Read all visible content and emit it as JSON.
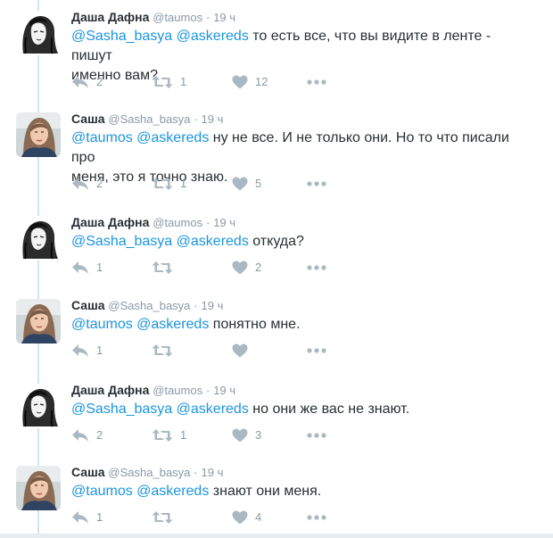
{
  "tweets": [
    {
      "author": "dasha",
      "name": "Даша Дафна",
      "handle": "@taumos",
      "dot": "·",
      "time": "19 ч",
      "mentions": "@Sasha_basya @askereds",
      "text_line1": " то есть все, что вы видите в ленте - пишут",
      "text_line2": "именно вам?",
      "replies": "2",
      "retweets": "1",
      "likes": "12"
    },
    {
      "author": "sasha",
      "name": "Саша",
      "handle": "@Sasha_basya",
      "dot": "·",
      "time": "19 ч",
      "mentions": "@taumos @askereds",
      "text_line1": " ну не все. И не только они. Но то что писали про",
      "text_line2": "меня, это я точно знаю.",
      "replies": "2",
      "retweets": "1",
      "likes": "5"
    },
    {
      "author": "dasha",
      "name": "Даша Дафна",
      "handle": "@taumos",
      "dot": "·",
      "time": "19 ч",
      "mentions": "@Sasha_basya @askereds",
      "text_line1": " откуда?",
      "text_line2": "",
      "replies": "1",
      "retweets": "",
      "likes": "2"
    },
    {
      "author": "sasha",
      "name": "Саша",
      "handle": "@Sasha_basya",
      "dot": "·",
      "time": "19 ч",
      "mentions": "@taumos @askereds",
      "text_line1": " понятно мне.",
      "text_line2": "",
      "replies": "1",
      "retweets": "",
      "likes": ""
    },
    {
      "author": "dasha",
      "name": "Даша Дафна",
      "handle": "@taumos",
      "dot": "·",
      "time": "19 ч",
      "mentions": "@Sasha_basya @askereds",
      "text_line1": " но они же вас не знают.",
      "text_line2": "",
      "replies": "2",
      "retweets": "1",
      "likes": "3"
    },
    {
      "author": "sasha",
      "name": "Саша",
      "handle": "@Sasha_basya",
      "dot": "·",
      "time": "19 ч",
      "mentions": "@taumos @askereds",
      "text_line1": " знают они меня.",
      "text_line2": "",
      "replies": "1",
      "retweets": "",
      "likes": "4"
    }
  ],
  "icons": {
    "reply": "reply-icon",
    "retweet": "retweet-icon",
    "like": "heart-icon",
    "more": "more-icon"
  },
  "colors": {
    "name": "#292f33",
    "meta": "#8899a6",
    "mention": "#1b95e0",
    "action_icon": "#aab8c2",
    "thread_line": "#cfe4f2"
  }
}
